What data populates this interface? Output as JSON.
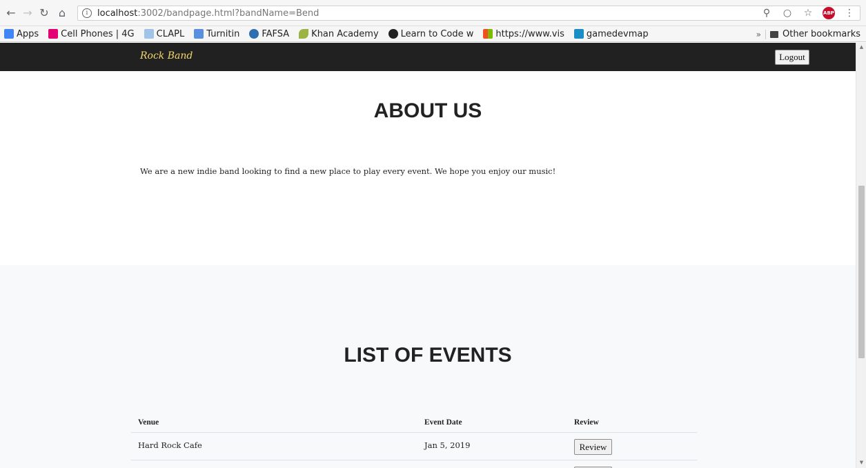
{
  "browser": {
    "url_host": "localhost",
    "url_rest": ":3002/bandpage.html?bandName=Bend",
    "info_icon": "i"
  },
  "bookmarks": [
    {
      "label": "Apps",
      "color": "#4285f4"
    },
    {
      "label": "Cell Phones | 4G",
      "color": "#e20074"
    },
    {
      "label": "CLAPL",
      "color": "#a0c4e8"
    },
    {
      "label": "Turnitin",
      "color": "#5a8ede"
    },
    {
      "label": "FAFSA",
      "color": "#2f6fb1"
    },
    {
      "label": "Khan Academy",
      "color": "#9cb443"
    },
    {
      "label": "Learn to Code w",
      "color": "#222222"
    },
    {
      "label": "https://www.vis",
      "color": "#f25022"
    },
    {
      "label": "gamedevmap",
      "color": "#1b8ec6"
    }
  ],
  "bookmarks_more": "»",
  "bookmarks_other": "Other bookmarks",
  "navbar": {
    "brand": "Rock Band",
    "logout": "Logout"
  },
  "about": {
    "title": "ABOUT US",
    "text": "We are a new indie band looking to find a new place to play every event. We hope you enjoy our music!"
  },
  "events": {
    "title": "LIST OF EVENTS",
    "columns": [
      "Venue",
      "Event Date",
      "Review"
    ],
    "rows": [
      {
        "venue": "Hard Rock Cafe",
        "date": "Jan 5, 2019",
        "action": "Review"
      }
    ]
  }
}
